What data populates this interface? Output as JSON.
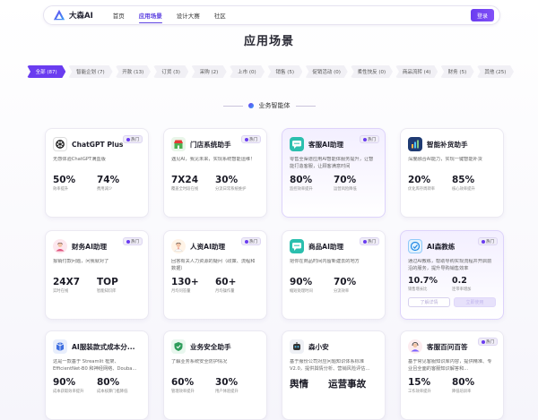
{
  "nav": {
    "brand": "大森AI",
    "links": [
      "首页",
      "应用场景",
      "设计大赛",
      "社区"
    ],
    "active_index": 1,
    "login_label": "登录"
  },
  "page_title": "应用场景",
  "filters": [
    "全部 (87)",
    "智能企划 (7)",
    "开款 (13)",
    "订货 (3)",
    "采购 (2)",
    "上市 (0)",
    "销售 (5)",
    "促销活动 (0)",
    "柔性快反 (0)",
    "商品流转 (4)",
    "财务 (5)",
    "其他 (25)"
  ],
  "section_title": "业务智能体",
  "badge_label": "热门",
  "colors": {
    "accent": "#6a3cf0",
    "badge_dot": "#6a3cf0"
  },
  "cards": [
    {
      "name": "ChatGPT Plus",
      "icon": "openai-icon",
      "desc": "无感体验ChatGPT满血版",
      "stats": [
        {
          "value": "50%",
          "label": "效率提升"
        },
        {
          "value": "74%",
          "label": "费用减少"
        }
      ]
    },
    {
      "name": "门店系统助手",
      "icon": "store-icon",
      "desc": "遇见AI，我见未来，实现系统智能运维！",
      "stats": [
        {
          "value": "7X24",
          "label": "覆盖全时段在线"
        },
        {
          "value": "30%",
          "label": "分流日常系统维护"
        }
      ]
    },
    {
      "name": "客服AI助理",
      "icon": "chat-icon",
      "desc": "零售全渠道应用AI智能体服务提升，让智能打造客服，让顾客满意时间",
      "stats": [
        {
          "value": "80%",
          "label": "监控效率提升"
        },
        {
          "value": "70%",
          "label": "运营风险降低"
        }
      ]
    },
    {
      "name": "智能补货助手",
      "icon": "chart-icon",
      "desc": "深度融合AI能力，实现一键智能补货",
      "stats": [
        {
          "value": "20%",
          "label": "优化库存周转率"
        },
        {
          "value": "85%",
          "label": "核心效率提升"
        }
      ]
    },
    {
      "name": "财务AI助理",
      "icon": "finance-avatar-icon",
      "desc": "报销付款问题，问我就对了",
      "stats": [
        {
          "value": "24X7",
          "label": "实时在线"
        },
        {
          "value": "TOP",
          "label": "智能知识库"
        }
      ]
    },
    {
      "name": "人资AI助理",
      "icon": "hr-avatar-icon",
      "desc": "回答有关人力资源的疑问（政策、流程和数据）",
      "stats": [
        {
          "value": "130+",
          "label": "月均问答量"
        },
        {
          "value": "60+",
          "label": "月均操作量"
        }
      ]
    },
    {
      "name": "商品AI助理",
      "icon": "product-icon",
      "desc": "把你在商品时间内留新建去的地方",
      "stats": [
        {
          "value": "90%",
          "label": "缩短处理时间"
        },
        {
          "value": "70%",
          "label": "分流效率"
        }
      ]
    },
    {
      "name": "AI森教练",
      "icon": "coach-icon",
      "desc": "通过AI教练，帮助导购实现流程并开启前沿的服务，提升导购销售效率",
      "stats": [
        {
          "value": "10.7%",
          "label": "销售增长比"
        },
        {
          "value": "0.2",
          "label": "连带率增加"
        }
      ],
      "actions": [
        "了解详情",
        "立即使用"
      ]
    },
    {
      "name": "AI服装款式成本分...",
      "icon": "cost-icon",
      "desc": "这是一款基于 Streamlit 框架、EfficientNet-B0 和神经网络、Douba...",
      "stats": [
        {
          "value": "90%",
          "label": "成本获取效率提升"
        },
        {
          "value": "80%",
          "label": "成本核算门槛降低"
        }
      ]
    },
    {
      "name": "业务安全助手",
      "icon": "shield-icon",
      "desc": "了解业务系统安全防护情况",
      "stats": [
        {
          "value": "60%",
          "label": "管理效率提升"
        },
        {
          "value": "30%",
          "label": "用户体验提升"
        }
      ]
    },
    {
      "name": "森小安",
      "icon": "robot-icon",
      "desc": "基于服份公司对应问题知识体系标准V2.0，提供舆情分析、营销风险评估...",
      "stats": [
        {
          "value": "舆情",
          "label": ""
        },
        {
          "value": "运营事故",
          "label": ""
        }
      ]
    },
    {
      "name": "客服百问百答",
      "icon": "service-icon",
      "desc": "基于常见客服知识库内容，提供精准、专业且全面的客服知识解答和...",
      "stats": [
        {
          "value": "15%",
          "label": "工作效率提升"
        },
        {
          "value": "80%",
          "label": "降低培训率"
        }
      ]
    }
  ]
}
